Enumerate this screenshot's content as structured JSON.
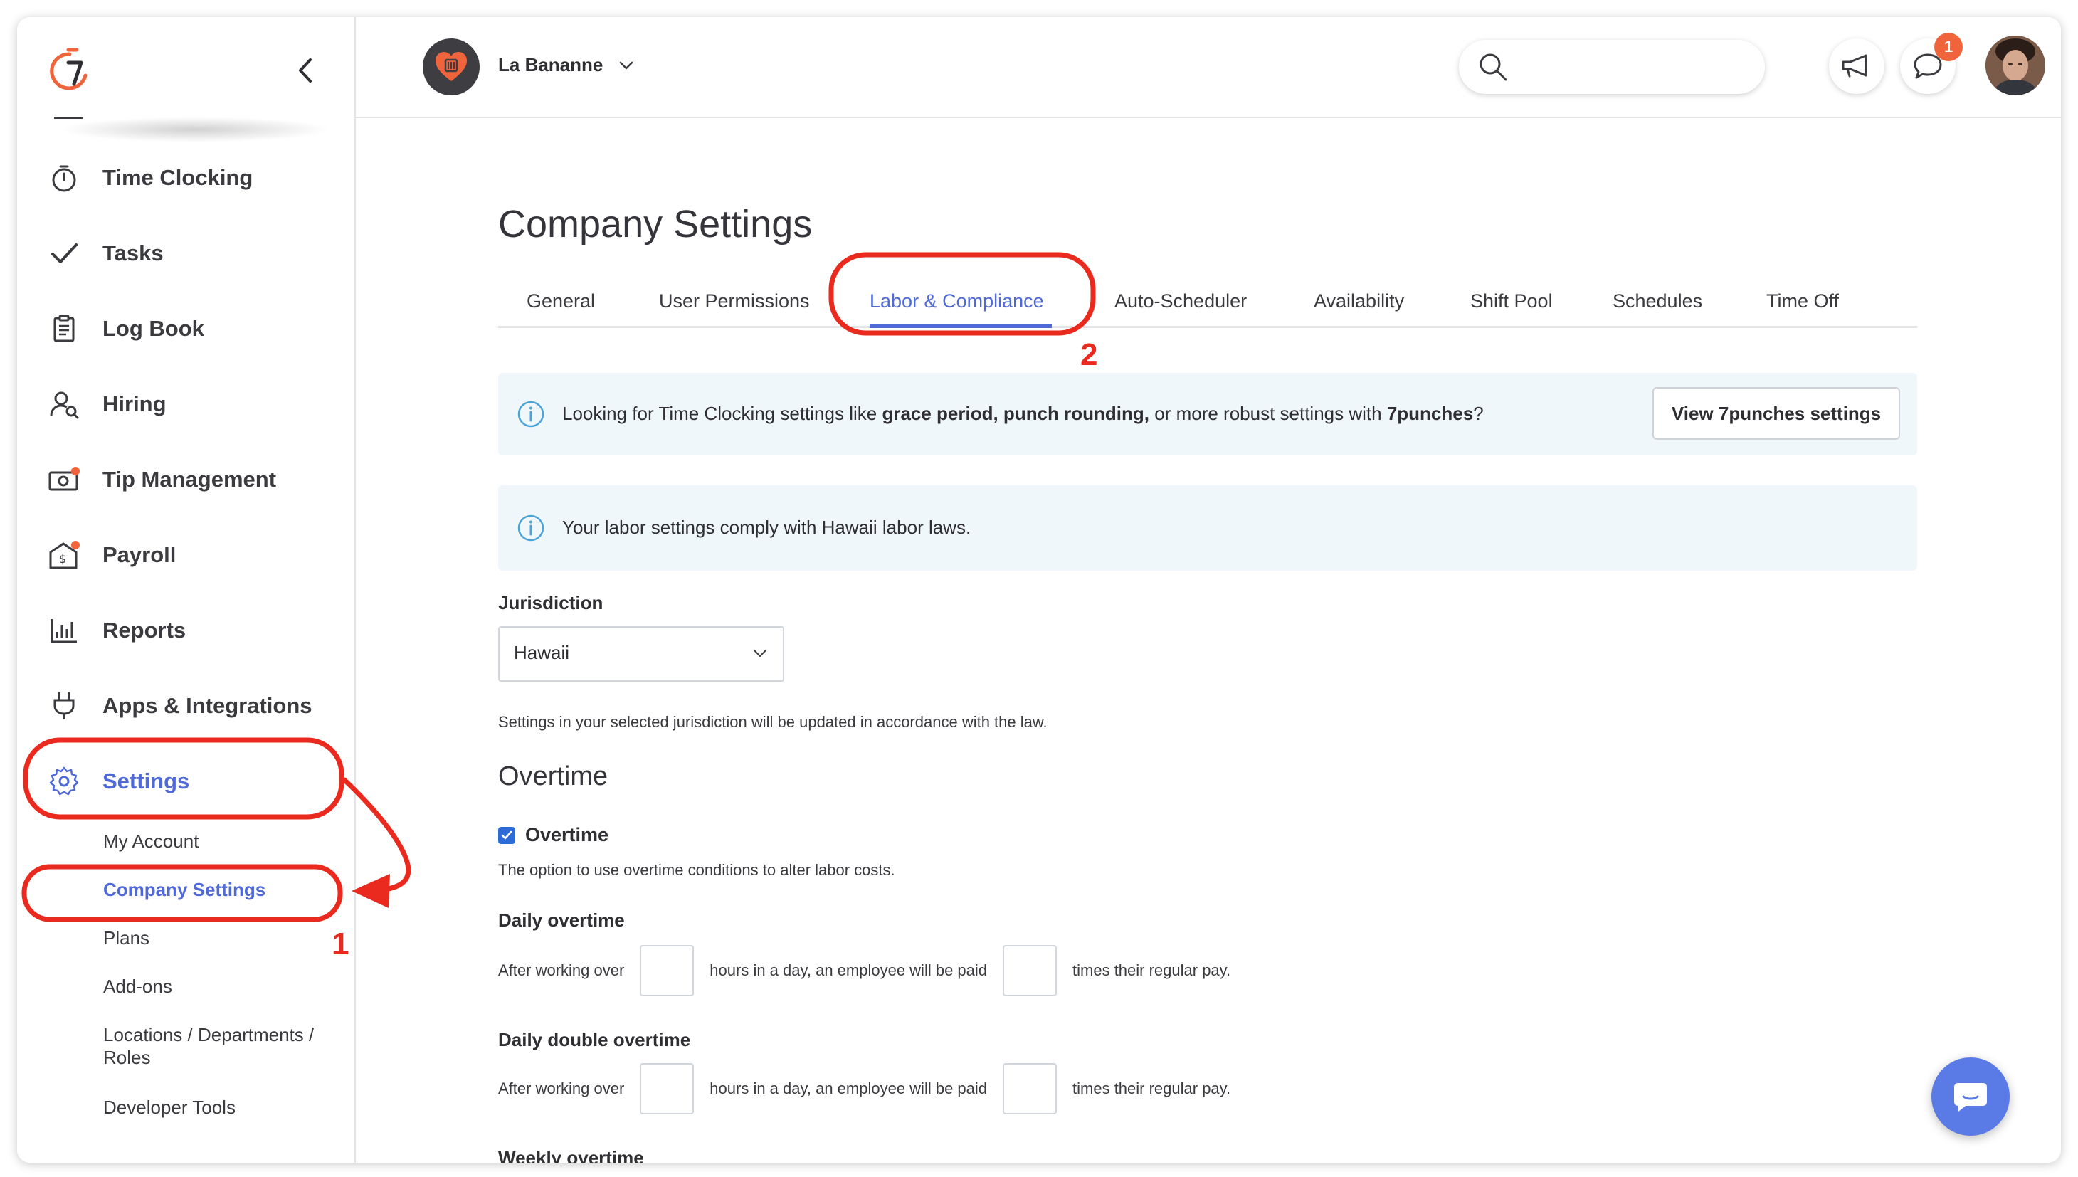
{
  "sidebar": {
    "items": [
      {
        "label": "Time Clocking",
        "icon": "stopwatch-icon"
      },
      {
        "label": "Tasks",
        "icon": "checkmark-icon"
      },
      {
        "label": "Log Book",
        "icon": "clipboard-icon"
      },
      {
        "label": "Hiring",
        "icon": "person-search-icon"
      },
      {
        "label": "Tip Management",
        "icon": "cash-icon"
      },
      {
        "label": "Payroll",
        "icon": "payroll-envelope-icon"
      },
      {
        "label": "Reports",
        "icon": "bar-chart-icon"
      },
      {
        "label": "Apps & Integrations",
        "icon": "plug-icon"
      },
      {
        "label": "Settings",
        "icon": "gear-icon"
      }
    ],
    "sub_items": [
      {
        "label": "My Account"
      },
      {
        "label": "Company Settings"
      },
      {
        "label": "Plans"
      },
      {
        "label": "Add-ons"
      },
      {
        "label": "Locations / Departments / Roles"
      },
      {
        "label": "Developer Tools"
      }
    ]
  },
  "header": {
    "company_name": "La Bananne",
    "search_placeholder": "",
    "notification_count": "1",
    "accent_color": "#f0643c"
  },
  "main": {
    "title": "Company Settings",
    "tabs": [
      {
        "label": "General"
      },
      {
        "label": "User Permissions"
      },
      {
        "label": "Labor & Compliance"
      },
      {
        "label": "Auto-Scheduler"
      },
      {
        "label": "Availability"
      },
      {
        "label": "Shift Pool"
      },
      {
        "label": "Schedules"
      },
      {
        "label": "Time Off"
      }
    ],
    "active_tab": "Labor & Compliance",
    "info_banner": {
      "text_1": "Looking for Time Clocking settings like ",
      "bold_1": "grace period, punch rounding,",
      "text_2": " or more robust settings with ",
      "bold_2": "7punches",
      "text_3": "?",
      "button_label": "View 7punches settings"
    },
    "compliance_banner": {
      "text": "Your labor settings comply with Hawaii labor laws."
    },
    "jurisdiction": {
      "label": "Jurisdiction",
      "selected": "Hawaii",
      "help": "Settings in your selected jurisdiction will be updated in accordance with the law."
    },
    "overtime": {
      "section_title": "Overtime",
      "checkbox_label": "Overtime",
      "checkbox_checked": true,
      "description": "The option to use overtime conditions to alter labor costs.",
      "daily": {
        "title": "Daily overtime",
        "prefix": "After working over",
        "middle": "hours in a day, an employee will be paid",
        "suffix": "times their regular pay.",
        "hours_value": "",
        "multiplier_value": ""
      },
      "daily_double": {
        "title": "Daily double overtime",
        "prefix": "After working over",
        "middle": "hours in a day, an employee will be paid",
        "suffix": "times their regular pay.",
        "hours_value": "",
        "multiplier_value": ""
      },
      "weekly": {
        "title": "Weekly overtime"
      }
    }
  },
  "annotations": {
    "step_1": "1",
    "step_2": "2",
    "color": "#ea2a1f"
  }
}
